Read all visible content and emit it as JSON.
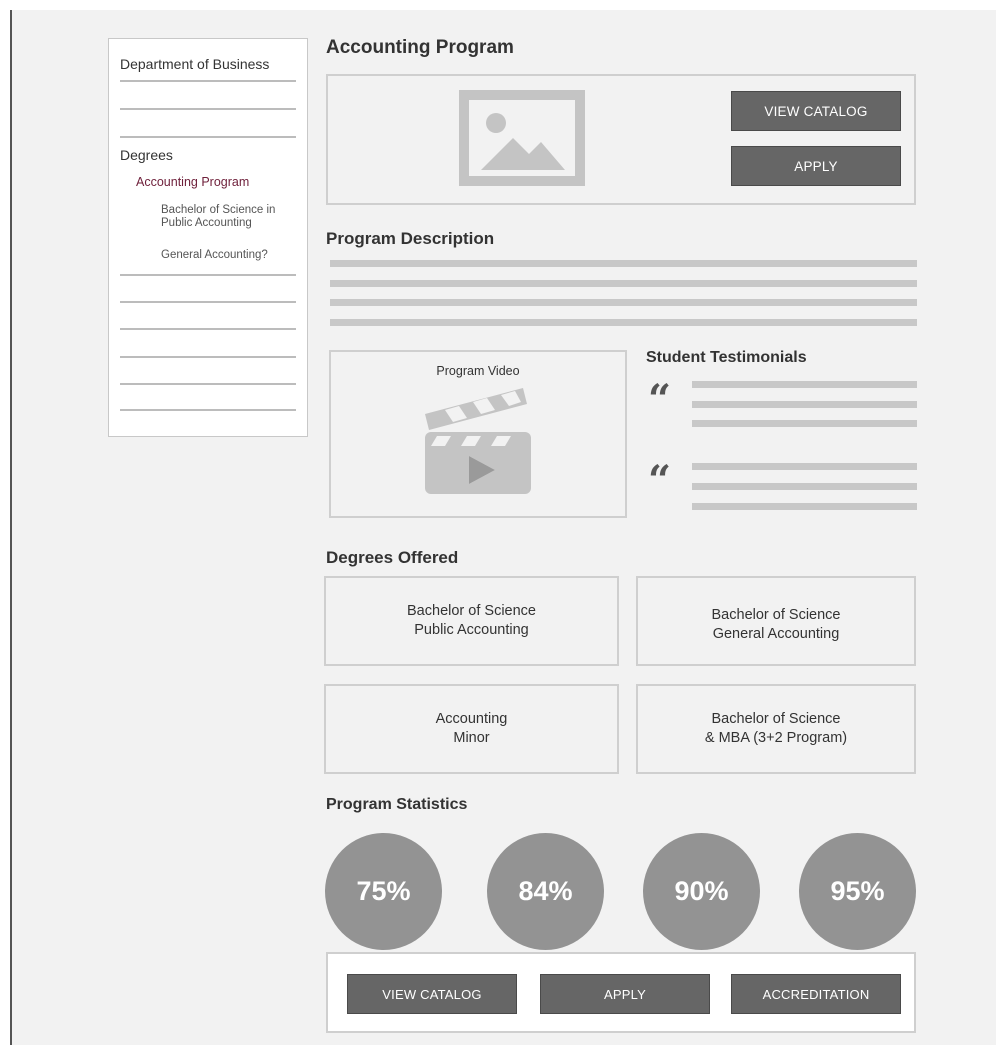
{
  "sidebar": {
    "department": "Department of Business",
    "degrees_heading": "Degrees",
    "active_item": "Accounting Program",
    "sub_items": [
      "Bachelor of Science in Public Accounting",
      "General Accounting?"
    ]
  },
  "page": {
    "title": "Accounting Program"
  },
  "hero": {
    "image_icon": "image-placeholder-icon",
    "buttons": {
      "view_catalog": "VIEW CATALOG",
      "apply": "APPLY"
    }
  },
  "description": {
    "heading": "Program Description"
  },
  "video": {
    "title": "Program Video",
    "icon": "clapperboard-play-icon"
  },
  "testimonials": {
    "heading": "Student Testimonials",
    "quote_icon": "quote-mark-icon"
  },
  "degrees_offered": {
    "heading": "Degrees Offered",
    "cards": [
      {
        "line1": "Bachelor of Science",
        "line2": "Public Accounting"
      },
      {
        "line1": "Bachelor of Science",
        "line2": "General Accounting"
      },
      {
        "line1": "Accounting",
        "line2": "Minor"
      },
      {
        "line1": "Bachelor of Science",
        "line2": "& MBA (3+2 Program)"
      }
    ]
  },
  "statistics": {
    "heading": "Program Statistics",
    "values": [
      "75%",
      "84%",
      "90%",
      "95%"
    ]
  },
  "footer": {
    "buttons": {
      "view_catalog": "VIEW CATALOG",
      "apply": "APPLY",
      "accreditation": "ACCREDITATION"
    }
  },
  "colors": {
    "background": "#f2f2f2",
    "button": "#666666",
    "active_link": "#6e1f3a",
    "stat_circle": "#939393",
    "placeholder": "#c8c8c8"
  }
}
